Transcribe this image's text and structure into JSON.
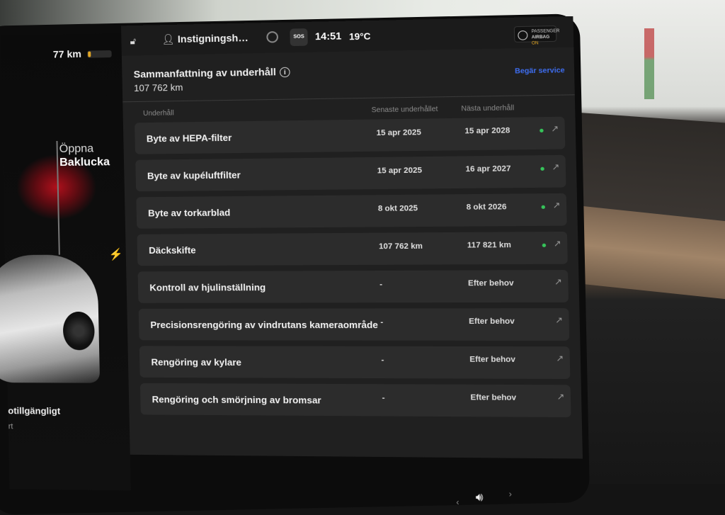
{
  "status_bar": {
    "range": "77 km",
    "profile": "Instigningsh…",
    "sos": "SOS",
    "time": "14:51",
    "temperature": "19°C",
    "airbag_line1": "PASSENGER",
    "airbag_line2": "AIRBAG",
    "airbag_state": "ON"
  },
  "vehicle": {
    "trunk_action": "Öppna",
    "trunk_label": "Baklucka",
    "availability": "otillgängligt",
    "availability_sub": "rt"
  },
  "maintenance": {
    "title": "Sammanfattning av underhåll",
    "odometer": "107 762  km",
    "request_service": "Begär service",
    "columns": [
      "Underhåll",
      "Senaste underhållet",
      "Nästa underhåll"
    ],
    "rows": [
      {
        "name": "Byte av HEPA-filter",
        "last": "15 apr 2025",
        "next": "15 apr 2028",
        "status": "ok"
      },
      {
        "name": "Byte av kupéluftfilter",
        "last": "15 apr 2025",
        "next": "16 apr 2027",
        "status": "ok"
      },
      {
        "name": "Byte av torkarblad",
        "last": "8 okt 2025",
        "next": "8 okt 2026",
        "status": "ok"
      },
      {
        "name": "Däckskifte",
        "last": "107 762 km",
        "next": "117 821 km",
        "status": "ok"
      },
      {
        "name": "Kontroll av hjulinställning",
        "last": "-",
        "next": "Efter behov",
        "status": ""
      },
      {
        "name": "Precisionsrengöring av vindrutans kameraområde",
        "last": "-",
        "next": "Efter behov",
        "status": ""
      },
      {
        "name": "Rengöring av kylare",
        "last": "-",
        "next": "Efter behov",
        "status": ""
      },
      {
        "name": "Rengöring och smörjning av bromsar",
        "last": "-",
        "next": "Efter behov",
        "status": ""
      }
    ]
  },
  "colors": {
    "link": "#3e6ef2",
    "status_ok": "#36c45a",
    "battery": "#e2a623"
  },
  "icons": [
    "lock-open-icon",
    "user-icon",
    "target-icon",
    "sos-icon",
    "airbag-icon",
    "info-icon",
    "arrow-up-right-icon",
    "bolt-icon",
    "volume-icon"
  ]
}
